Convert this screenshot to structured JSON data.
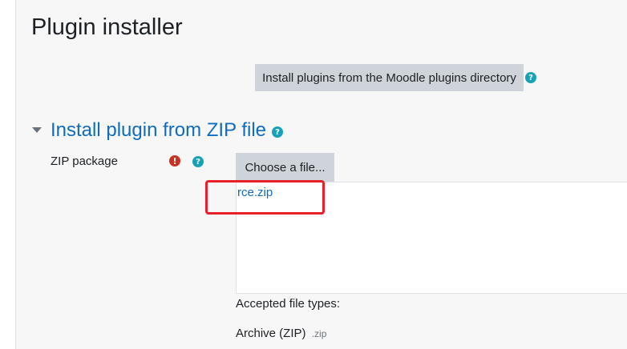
{
  "page": {
    "title": "Plugin installer"
  },
  "directory": {
    "button_label": "Install plugins from the Moodle plugins directory",
    "help_glyph": "?"
  },
  "zip_section": {
    "title": "Install plugin from ZIP file",
    "help_glyph": "?",
    "field_label": "ZIP package",
    "required_glyph": "!",
    "field_help_glyph": "?",
    "choose_button_label": "Choose a file...",
    "selected_file": "rce.zip",
    "accepted_label": "Accepted file types:",
    "accepted_type_name": "Archive (ZIP)",
    "accepted_type_ext": ".zip"
  },
  "icons": {
    "toggle": "chevron-down-icon",
    "help": "question-circle-icon",
    "required": "exclamation-circle-icon"
  },
  "colors": {
    "link": "#0f6cbf",
    "button_bg": "#ced4da",
    "help": "#17a2b8",
    "required": "#ca3120",
    "highlight": "#e8202a",
    "background": "#f7f7f7"
  }
}
